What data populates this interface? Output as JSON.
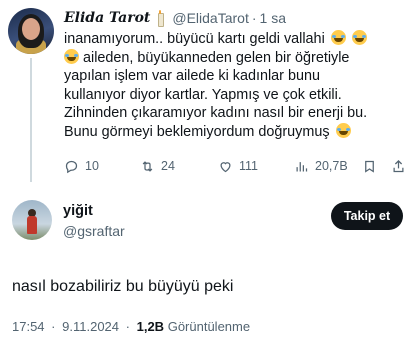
{
  "reply": {
    "display_name": "Elida Tarot",
    "name_icon": "candle-emoji",
    "handle": "@ElidaTarot",
    "sep": "·",
    "time_ago": "1 sa",
    "lines": [
      "inanamıyorum.. büyücü kartı geldi vallahi",
      "aileden, büyükanneden gelen bir öğretiyle",
      "yapılan işlem var ailede ki kadınlar bunu",
      "kullanıyor diyor kartlar. Yapmış ve çok etkili.",
      "Zihninden çıkaramıyor kadını nasıl bir enerji bu.",
      "Bunu görmeyi beklemiyordum doğruymuş"
    ],
    "emoji": "laughing-with-tears-emoji",
    "actions": {
      "replies": "10",
      "reposts": "24",
      "likes": "111",
      "views": "20,7B"
    }
  },
  "main": {
    "display_name": "yiğit",
    "handle": "@gsraftar",
    "follow_label": "Takip et",
    "text": "nasıl bozabiliriz bu büyüyü peki",
    "time": "17:54",
    "date": "9.11.2024",
    "sep": "·",
    "views_count": "1,2B",
    "views_label": "Görüntülenme"
  },
  "colors": {
    "text_primary": "#0f1419",
    "text_secondary": "#536471",
    "button_bg": "#0f1419",
    "thread_line": "#cfd9de"
  }
}
